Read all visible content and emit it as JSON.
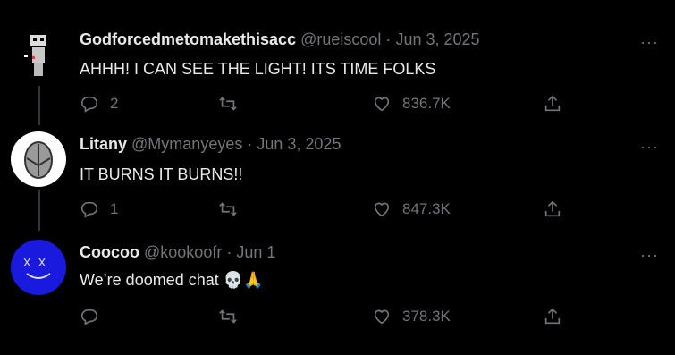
{
  "tweets": [
    {
      "name": "Godforcedmetomakethisacc",
      "handle": "@rueiscool",
      "date": "Jun 3, 2025",
      "text": "AHHH! I CAN SEE THE LIGHT! ITS TIME FOLKS",
      "replies": "2",
      "likes": "836.7K"
    },
    {
      "name": "Litany",
      "handle": "@Mymanyeyes",
      "date": "Jun 3, 2025",
      "text": "IT BURNS IT BURNS!!",
      "replies": "1",
      "likes": "847.3K"
    },
    {
      "name": "Coocoo",
      "handle": "@kookoofr",
      "date": "Jun 1",
      "text": "We’re doomed chat",
      "emoji": "💀🙏",
      "replies": "",
      "likes": "378.3K"
    }
  ],
  "separator": "·",
  "more_label": "···",
  "icons": {
    "reply": "reply-icon",
    "retweet": "retweet-icon",
    "like": "heart-icon",
    "share": "share-icon"
  },
  "colors": {
    "background": "#000000",
    "text": "#e7e9ea",
    "muted": "#71767b",
    "thread_line": "#333639"
  }
}
